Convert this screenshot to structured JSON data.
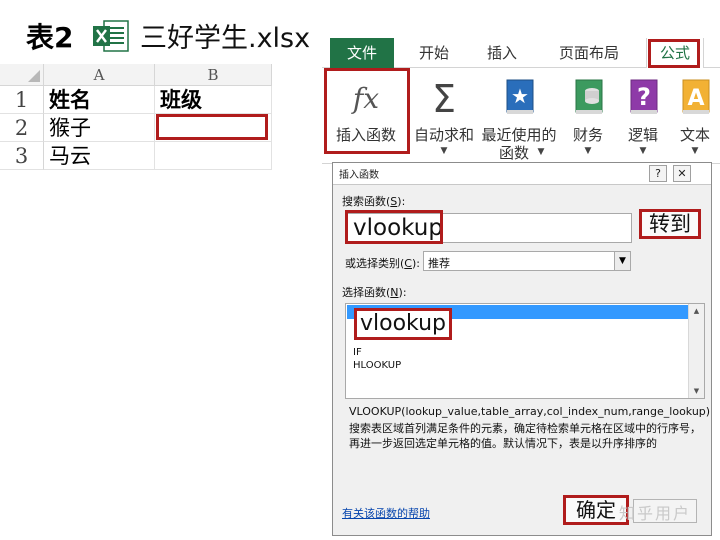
{
  "title": {
    "label": "表2",
    "file_name": "三好学生.xlsx",
    "icon": "excel-file-icon"
  },
  "sheet": {
    "columns": [
      "A",
      "B"
    ],
    "rows": [
      {
        "num": "1",
        "a": "姓名",
        "b": "班级"
      },
      {
        "num": "2",
        "a": "猴子",
        "b": ""
      },
      {
        "num": "3",
        "a": "马云",
        "b": ""
      }
    ]
  },
  "ribbon": {
    "tabs": [
      "文件",
      "开始",
      "插入",
      "页面布局",
      "公式"
    ],
    "active_tab": "公式",
    "buttons": [
      {
        "label": "插入函数",
        "icon": "fx-icon"
      },
      {
        "label": "自动求和",
        "icon": "sigma-icon"
      },
      {
        "label_line1": "最近使用的",
        "label_line2": "函数",
        "icon": "star-book-icon"
      },
      {
        "label": "财务",
        "icon": "finance-book-icon"
      },
      {
        "label": "逻辑",
        "icon": "question-book-icon"
      },
      {
        "label": "文本",
        "icon": "text-book-icon"
      }
    ]
  },
  "dialog": {
    "title": "插入函数",
    "help_symbol": "?",
    "close_symbol": "✕",
    "search_label": "搜索函数(",
    "search_key": "S",
    "search_label_end": "):",
    "search_value": "vlookup",
    "go_label": "转到",
    "category_label": "或选择类别(",
    "category_key": "C",
    "category_label_end": "):",
    "category_value": "推荐",
    "functions_label": "选择函数(",
    "functions_key": "N",
    "functions_label_end": "):",
    "functions": [
      "vlookup",
      "IF",
      "HLOOKUP"
    ],
    "signature": "VLOOKUP(lookup_value,table_array,col_index_num,range_lookup)",
    "description": "搜索表区域首列满足条件的元素，确定待检索单元格在区域中的行序号，再进一步返回选定单元格的值。默认情况下，表是以升序排序的",
    "help_link": "有关该函数的帮助",
    "ok_label": "确定",
    "watermark": "知乎用户"
  },
  "colors": {
    "excel_green": "#217346",
    "highlight_red": "#b01c1c",
    "selection_blue": "#3399ff"
  }
}
